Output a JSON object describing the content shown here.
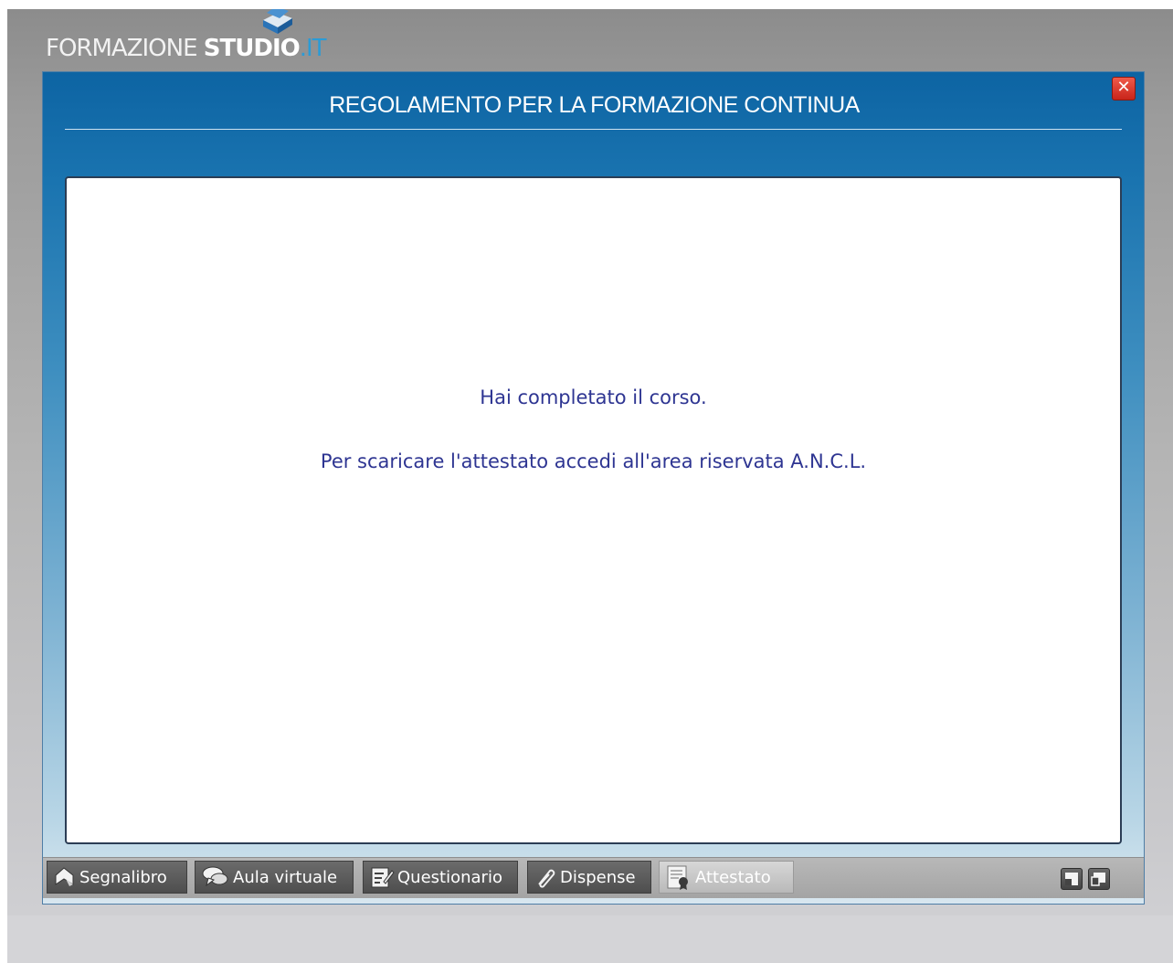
{
  "brand": {
    "part1": "FORMAZIONE ",
    "part2": "STUDIO",
    "part3": ".IT"
  },
  "window": {
    "title": "REGOLAMENTO PER LA FORMAZIONE CONTINUA",
    "close_label": "✕"
  },
  "message": {
    "line1": "Hai completato il corso.",
    "line2": "Per scaricare l'attestato accedi all'area riservata A.N.C.L."
  },
  "toolbar": {
    "segnalibro": "Segnalibro",
    "aula_virtuale": "Aula virtuale",
    "questionario": "Questionario",
    "dispense": "Dispense",
    "attestato": "Attestato"
  },
  "colors": {
    "header_blue": "#0d64a3",
    "message_text": "#2e3592",
    "close_red": "#d42e22",
    "brand_accent": "#2b9bd6"
  },
  "icons": [
    "books-icon",
    "close-icon",
    "bookmark-icon",
    "chat-icon",
    "questionnaire-icon",
    "paperclip-icon",
    "certificate-icon",
    "window-restore-icon",
    "window-popout-icon"
  ]
}
